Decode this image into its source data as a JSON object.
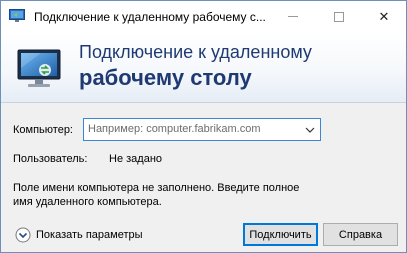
{
  "window": {
    "title": "Подключение к удаленному рабочему с...",
    "close_symbol": "✕"
  },
  "banner": {
    "line1": "Подключение к удаленному",
    "line2": "рабочему столу"
  },
  "form": {
    "computer_label": "Компьютер:",
    "computer_placeholder": "Например: computer.fabrikam.com",
    "user_label": "Пользователь:",
    "user_value": "Не задано",
    "info_text": "Поле имени компьютера не заполнено. Введите полное имя удаленного компьютера."
  },
  "footer": {
    "options_label": "Показать параметры",
    "connect_label": "Подключить",
    "help_label": "Справка"
  },
  "icons": {
    "app": "remote-desktop-icon",
    "banner": "remote-desktop-monitor-icon",
    "dropdown": "chevron-down-icon",
    "options": "expand-circle-icon"
  },
  "colors": {
    "accent": "#0078d7",
    "banner_text": "#1f3a73"
  }
}
